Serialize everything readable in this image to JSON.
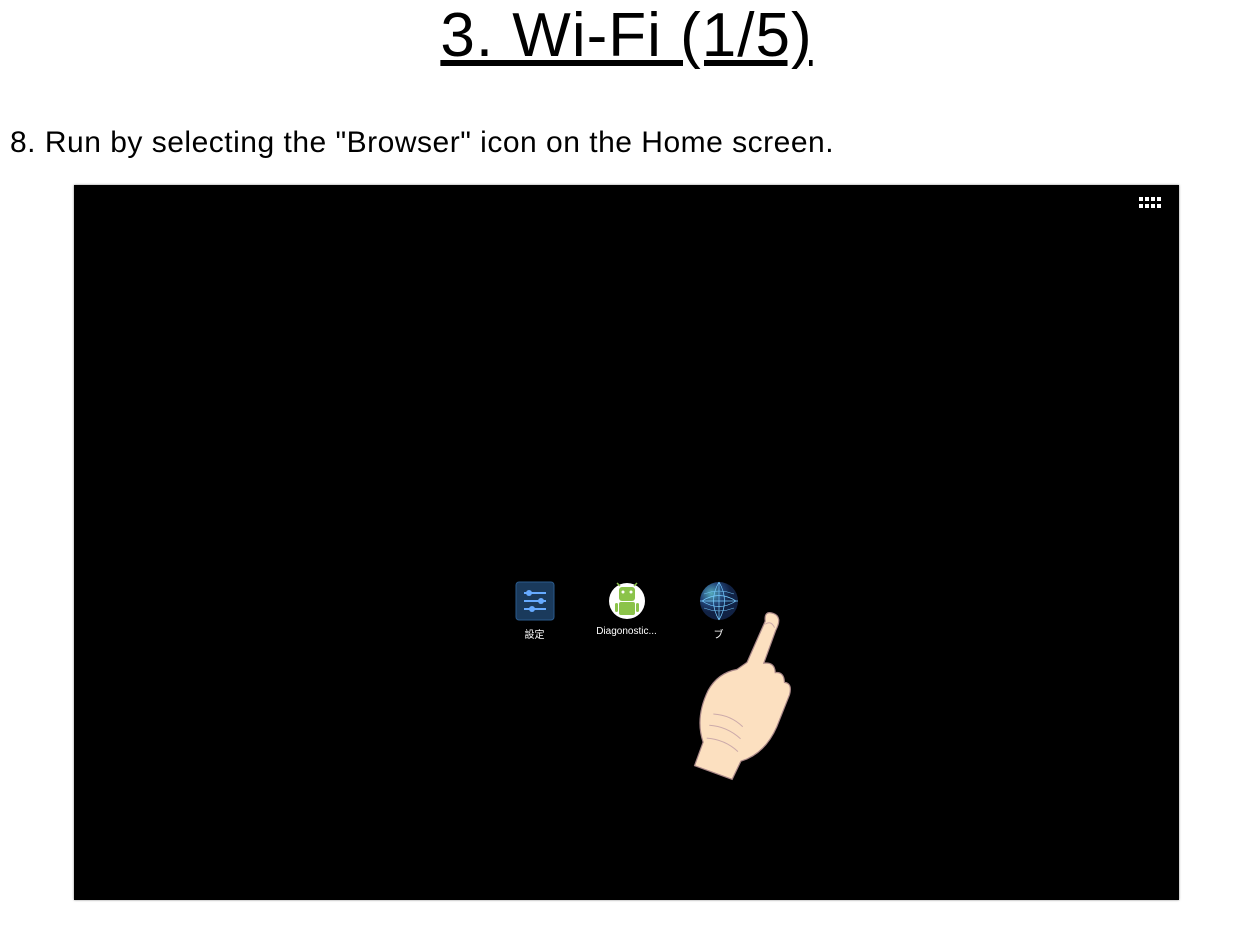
{
  "title": "3. Wi-Fi (1/5)",
  "instruction": "8. Run by selecting the \"Browser\" icon on the Home screen.",
  "home_screen": {
    "apps": [
      {
        "label": "設定",
        "name": "settings"
      },
      {
        "label": "Diagonostic...",
        "name": "diagnostic"
      },
      {
        "label": "ブ",
        "name": "browser"
      }
    ]
  }
}
